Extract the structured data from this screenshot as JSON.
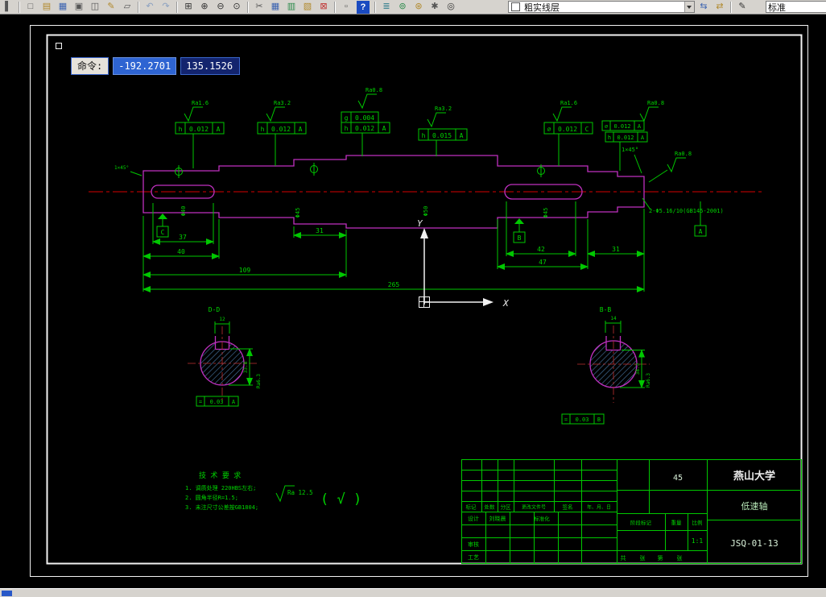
{
  "toolbar": {
    "icons": [
      {
        "name": "partial-left-icon",
        "glyph": "▌"
      },
      {
        "name": "new-file-icon",
        "glyph": "□"
      },
      {
        "name": "open-file-icon",
        "glyph": "▤"
      },
      {
        "name": "save-icon",
        "glyph": "▦"
      },
      {
        "name": "plot-icon",
        "glyph": "▣"
      },
      {
        "name": "preview-icon",
        "glyph": "◫"
      },
      {
        "name": "pencil-icon",
        "glyph": "✎"
      },
      {
        "name": "copy-icon",
        "glyph": "▱"
      },
      {
        "name": "undo-icon",
        "glyph": "↶"
      },
      {
        "name": "redo-icon",
        "glyph": "↷"
      },
      {
        "name": "zoom-window-icon",
        "glyph": "⊞"
      },
      {
        "name": "zoom-in-icon",
        "glyph": "⊕"
      },
      {
        "name": "zoom-out-icon",
        "glyph": "⊖"
      },
      {
        "name": "zoom-extents-icon",
        "glyph": "⊙"
      },
      {
        "name": "cut-icon",
        "glyph": "✂"
      },
      {
        "name": "table-icon",
        "glyph": "▦"
      },
      {
        "name": "chart-icon",
        "glyph": "▥"
      },
      {
        "name": "image-icon",
        "glyph": "▧"
      },
      {
        "name": "delete-icon",
        "glyph": "⊠"
      },
      {
        "name": "insert-block-icon",
        "glyph": "▫"
      },
      {
        "name": "help-icon",
        "glyph": "?"
      },
      {
        "name": "layers-icon",
        "glyph": "≣"
      },
      {
        "name": "point-icon",
        "glyph": "⊚"
      },
      {
        "name": "snap-icon",
        "glyph": "⊛"
      },
      {
        "name": "settings-icon",
        "glyph": "✱"
      },
      {
        "name": "donut-icon",
        "glyph": "◎"
      },
      {
        "name": "match-properties-icon",
        "glyph": "⇆"
      },
      {
        "name": "layer-swap-icon",
        "glyph": "⇄"
      },
      {
        "name": "pen-icon",
        "glyph": "✎"
      },
      {
        "name": "style-pen-icon",
        "glyph": "✎"
      },
      {
        "name": "partial-right-icon",
        "glyph": "▐"
      }
    ],
    "layer_dropdown": {
      "value": "粗实线层",
      "swatch_color": "#ffffff"
    },
    "style_dropdown": {
      "value": "标准"
    }
  },
  "command_overlay": {
    "label": "命令:",
    "x": "-192.2701",
    "y": "135.1526"
  },
  "drawing": {
    "colors": {
      "dimension": "#00c800",
      "outline": "#c030c0",
      "centerline": "#d40000"
    },
    "dims": {
      "kw_left": "37",
      "seg_left": "40",
      "seg3": "31",
      "left_group": "109",
      "overall": "265",
      "kw_right": "42",
      "seg_right": "47",
      "end_right": "31"
    },
    "dia_labels": {
      "d1": "Φ40",
      "d2": "Φ45",
      "d3": "Φ50",
      "d4": "Φ45"
    },
    "roughness": {
      "r1": "Ra1.6",
      "r2": "Ra3.2",
      "r3": "Ra0.8",
      "r4": "Ra3.2",
      "r5": "Ra1.6",
      "r6": "Ra0.8",
      "r7": "Ra0.8"
    },
    "chamfer_left": "1×45°",
    "chamfer_right": "1×45°",
    "center_holes": "2-Φ5.16/10(GB145-2001)",
    "frames": {
      "f1": {
        "sym": "h",
        "val": "0.012",
        "dat": "A"
      },
      "f2": {
        "sym": "h",
        "val": "0.012",
        "dat": "A"
      },
      "f3a": {
        "sym": "g",
        "val": "0.004"
      },
      "f3b": {
        "sym": "h",
        "val": "0.012",
        "dat": "A"
      },
      "f4": {
        "sym": "h",
        "val": "0.015",
        "dat": "A"
      },
      "f5": {
        "sym": "⌀",
        "val": "0.012",
        "dat": "C"
      },
      "f6": {
        "sym": "⌀",
        "val": "0.012",
        "dat": "A"
      },
      "f7": {
        "sym": "h",
        "val": "0.012",
        "dat": "A"
      }
    },
    "datums": {
      "c": "C",
      "b": "B",
      "a": "A"
    },
    "ucs": {
      "x_label": "X",
      "y_label": "Y"
    },
    "sections": {
      "dd": {
        "label": "D-D",
        "width_dim": "12",
        "depth_dim": "33.8",
        "roughness": "Ra6.3",
        "frame": {
          "sym": "=",
          "val": "0.03",
          "dat": "A"
        }
      },
      "bb": {
        "label": "B-B",
        "width_dim": "14",
        "depth_dim": "38.3",
        "roughness": "Ra6.3",
        "frame": {
          "sym": "=",
          "val": "0.03",
          "dat": "B"
        }
      }
    },
    "tech_req": {
      "title": "技 术 要 求",
      "line1": "1. 调质处理 220HBS左右;",
      "line2": "2. 圆角半径R=1.5;",
      "line3": "3. 未注尺寸公差按GB1804;"
    },
    "general_roughness": {
      "value": "Ra 12.5",
      "other": "( √ )"
    }
  },
  "title_block": {
    "university": "燕山大学",
    "part_name": "低速轴",
    "drawing_no": "JSQ-01-13",
    "material": "45",
    "scale": "1:1",
    "headers": {
      "h1": "标记",
      "h2": "处数",
      "h3": "分区",
      "h4": "更改文件号",
      "h5": "签名",
      "h6": "年、月、日"
    },
    "rows": {
      "design": "设计",
      "designer": "刘晓晨",
      "standard": "标准化",
      "check": "审核",
      "process": "工艺"
    },
    "labels": {
      "stage": "阶段标记",
      "weight": "重量",
      "ratio": "比例",
      "total": "共",
      "sheet": "张",
      "no": "第",
      "sheet2": "张"
    }
  }
}
